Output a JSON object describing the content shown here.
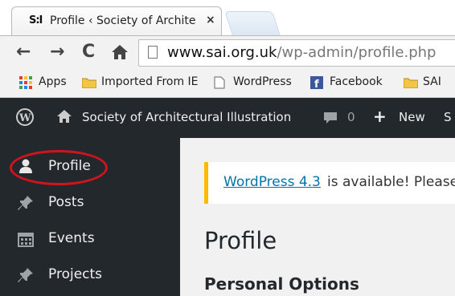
{
  "browser": {
    "tab_favicon_text": "S:I",
    "tab_title": "Profile ‹ Society of Archite",
    "tab_close": "×",
    "url_host": "www.sai.org.uk",
    "url_path": "/wp-admin/profile.php",
    "nav_icons": [
      "back-arrow-icon",
      "forward-arrow-icon",
      "reload-icon",
      "home-icon"
    ]
  },
  "bookmarks": [
    {
      "label": "Apps",
      "icon": "apps-grid-icon"
    },
    {
      "label": "Imported From IE",
      "icon": "folder-icon"
    },
    {
      "label": "WordPress",
      "icon": "page-icon"
    },
    {
      "label": "Facebook",
      "icon": "facebook-icon"
    },
    {
      "label": "SAI",
      "icon": "folder-icon"
    }
  ],
  "adminbar": {
    "site_name": "Society of Architectural Illustration",
    "comments_count": "0",
    "new_label": "New",
    "cut_label": "S"
  },
  "sidebar": {
    "items": [
      {
        "label": "Profile",
        "icon": "user-icon",
        "active": true
      },
      {
        "label": "Posts",
        "icon": "pin-icon"
      },
      {
        "label": "Events",
        "icon": "calendar-icon"
      },
      {
        "label": "Projects",
        "icon": "pin-icon"
      }
    ]
  },
  "content": {
    "notice_link": "WordPress 4.3",
    "notice_rest": " is available! Please",
    "page_title": "Profile",
    "section_title": "Personal Options"
  },
  "colors": {
    "admin_dark": "#23282d",
    "notice_border": "#ffba00",
    "link": "#0073aa",
    "annotation_red": "#d0141e"
  }
}
